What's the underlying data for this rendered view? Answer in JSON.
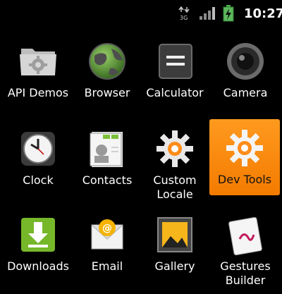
{
  "status_bar": {
    "network_type": "3G",
    "time": "10:27",
    "icons": [
      "3g-data-icon",
      "signal-strength-icon",
      "battery-charging-icon"
    ]
  },
  "apps": [
    {
      "label": "API Demos",
      "icon": "folder-gear-icon"
    },
    {
      "label": "Browser",
      "icon": "globe-icon"
    },
    {
      "label": "Calculator",
      "icon": "calculator-icon"
    },
    {
      "label": "Camera",
      "icon": "camera-lens-icon"
    },
    {
      "label": "Clock",
      "icon": "clock-icon"
    },
    {
      "label": "Contacts",
      "icon": "contacts-card-icon"
    },
    {
      "label": "Custom\nLocale",
      "icon": "gear-icon"
    },
    {
      "label": "Dev Tools",
      "icon": "gear-icon",
      "selected": true
    },
    {
      "label": "Downloads",
      "icon": "download-arrow-icon"
    },
    {
      "label": "Email",
      "icon": "email-envelope-icon"
    },
    {
      "label": "Gallery",
      "icon": "picture-frame-icon"
    },
    {
      "label": "Gestures\nBuilder",
      "icon": "gesture-pad-icon"
    }
  ],
  "colors": {
    "background": "#000000",
    "selection_highlight": "#ff8c1a",
    "label_text": "#ffffff"
  }
}
